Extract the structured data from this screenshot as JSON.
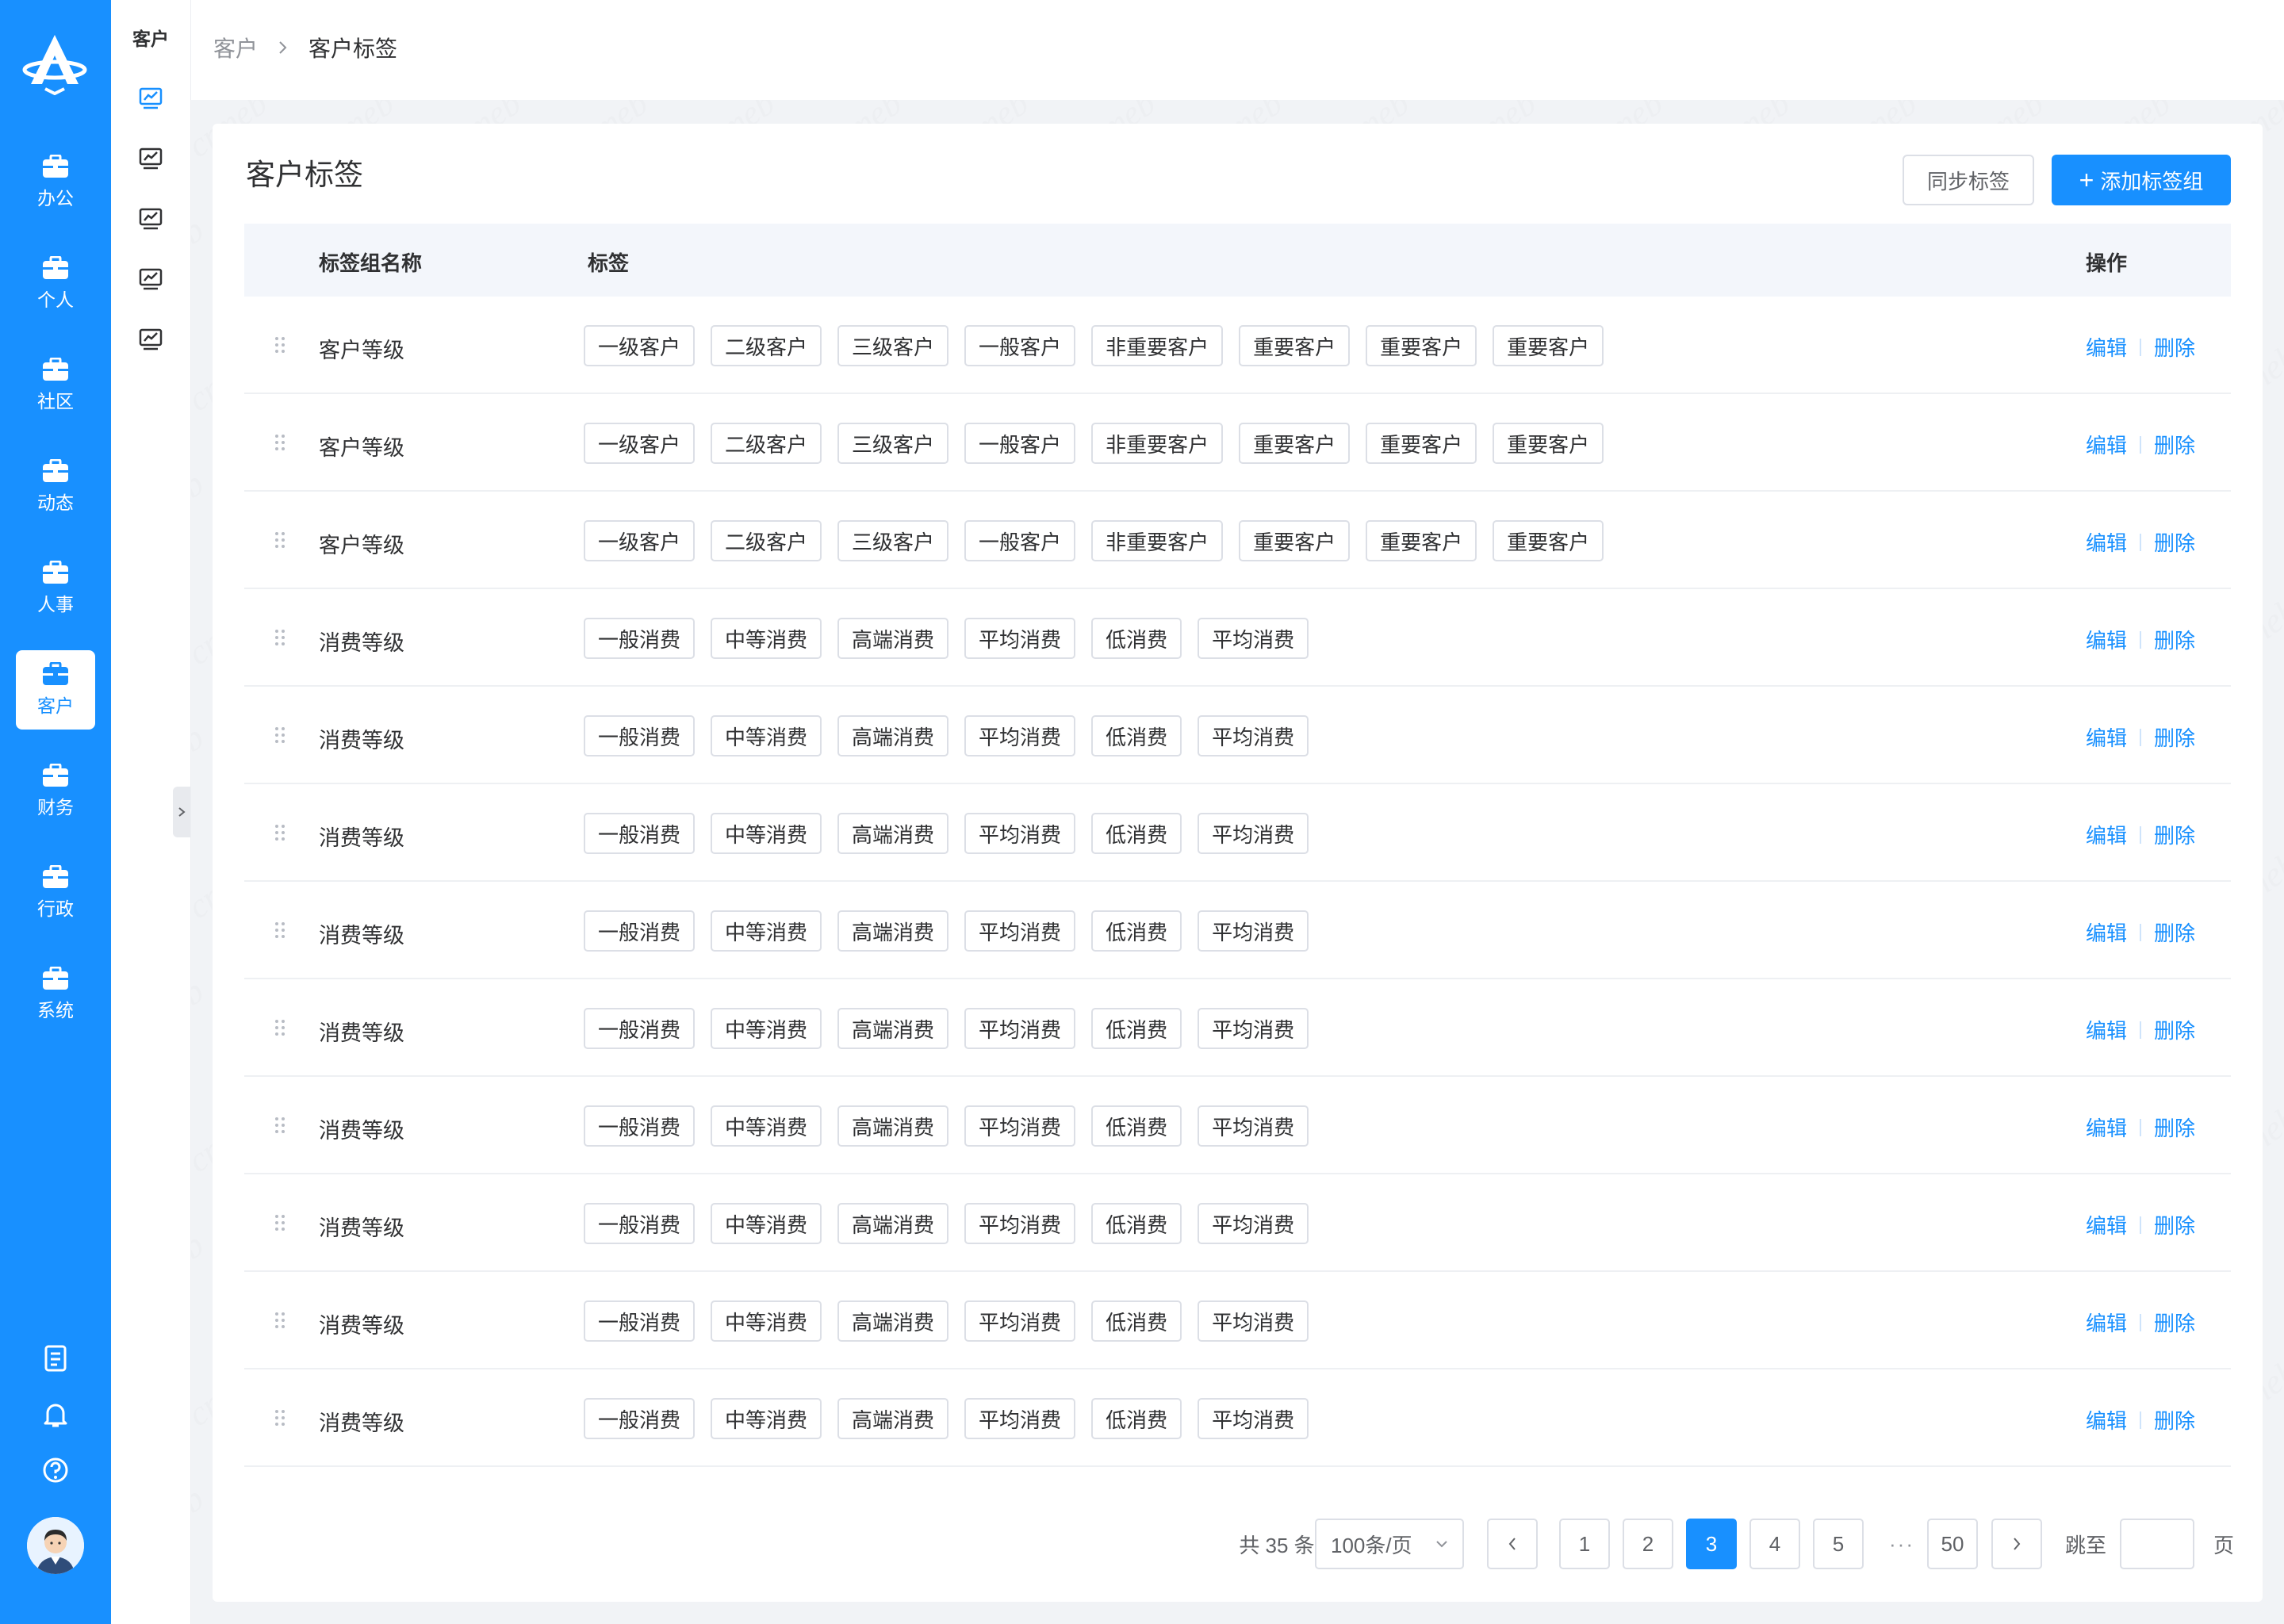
{
  "nav": {
    "items": [
      {
        "label": "办公",
        "active": false
      },
      {
        "label": "个人",
        "active": false
      },
      {
        "label": "社区",
        "active": false
      },
      {
        "label": "动态",
        "active": false
      },
      {
        "label": "人事",
        "active": false
      },
      {
        "label": "客户",
        "active": true
      },
      {
        "label": "财务",
        "active": false
      },
      {
        "label": "行政",
        "active": false
      },
      {
        "label": "系统",
        "active": false
      }
    ],
    "bottom_icons": [
      "notebook-icon",
      "bell-icon",
      "help-icon"
    ]
  },
  "subnav": {
    "title": "客户",
    "icon_count": 5
  },
  "breadcrumb": {
    "parent": "客户",
    "current": "客户标签"
  },
  "page": {
    "title": "客户标签",
    "sync_label": "同步标签",
    "add_label": "添加标签组"
  },
  "table": {
    "headers": {
      "name": "标签组名称",
      "tags": "标签",
      "ops": "操作"
    },
    "edit_label": "编辑",
    "delete_label": "删除",
    "rows": [
      {
        "name": "客户等级",
        "tags": [
          "一级客户",
          "二级客户",
          "三级客户",
          "一般客户",
          "非重要客户",
          "重要客户",
          "重要客户",
          "重要客户"
        ]
      },
      {
        "name": "客户等级",
        "tags": [
          "一级客户",
          "二级客户",
          "三级客户",
          "一般客户",
          "非重要客户",
          "重要客户",
          "重要客户",
          "重要客户"
        ]
      },
      {
        "name": "客户等级",
        "tags": [
          "一级客户",
          "二级客户",
          "三级客户",
          "一般客户",
          "非重要客户",
          "重要客户",
          "重要客户",
          "重要客户"
        ]
      },
      {
        "name": "消费等级",
        "tags": [
          "一般消费",
          "中等消费",
          "高端消费",
          "平均消费",
          "低消费",
          "平均消费"
        ]
      },
      {
        "name": "消费等级",
        "tags": [
          "一般消费",
          "中等消费",
          "高端消费",
          "平均消费",
          "低消费",
          "平均消费"
        ]
      },
      {
        "name": "消费等级",
        "tags": [
          "一般消费",
          "中等消费",
          "高端消费",
          "平均消费",
          "低消费",
          "平均消费"
        ]
      },
      {
        "name": "消费等级",
        "tags": [
          "一般消费",
          "中等消费",
          "高端消费",
          "平均消费",
          "低消费",
          "平均消费"
        ]
      },
      {
        "name": "消费等级",
        "tags": [
          "一般消费",
          "中等消费",
          "高端消费",
          "平均消费",
          "低消费",
          "平均消费"
        ]
      },
      {
        "name": "消费等级",
        "tags": [
          "一般消费",
          "中等消费",
          "高端消费",
          "平均消费",
          "低消费",
          "平均消费"
        ]
      },
      {
        "name": "消费等级",
        "tags": [
          "一般消费",
          "中等消费",
          "高端消费",
          "平均消费",
          "低消费",
          "平均消费"
        ]
      },
      {
        "name": "消费等级",
        "tags": [
          "一般消费",
          "中等消费",
          "高端消费",
          "平均消费",
          "低消费",
          "平均消费"
        ]
      },
      {
        "name": "消费等级",
        "tags": [
          "一般消费",
          "中等消费",
          "高端消费",
          "平均消费",
          "低消费",
          "平均消费"
        ]
      }
    ]
  },
  "pagination": {
    "total_text": "共 35 条",
    "page_size": "100条/页",
    "pages": [
      "1",
      "2",
      "3",
      "4",
      "5"
    ],
    "current_page": "3",
    "ellipsis": "···",
    "last_page": "50",
    "jump_label": "跳至",
    "page_suffix": "页",
    "jump_value": ""
  },
  "watermark": "crmeb",
  "colors": {
    "primary": "#1890ff",
    "background": "#f1f3f6",
    "text": "#303133",
    "muted": "#909399",
    "border": "#dcdfe6"
  }
}
